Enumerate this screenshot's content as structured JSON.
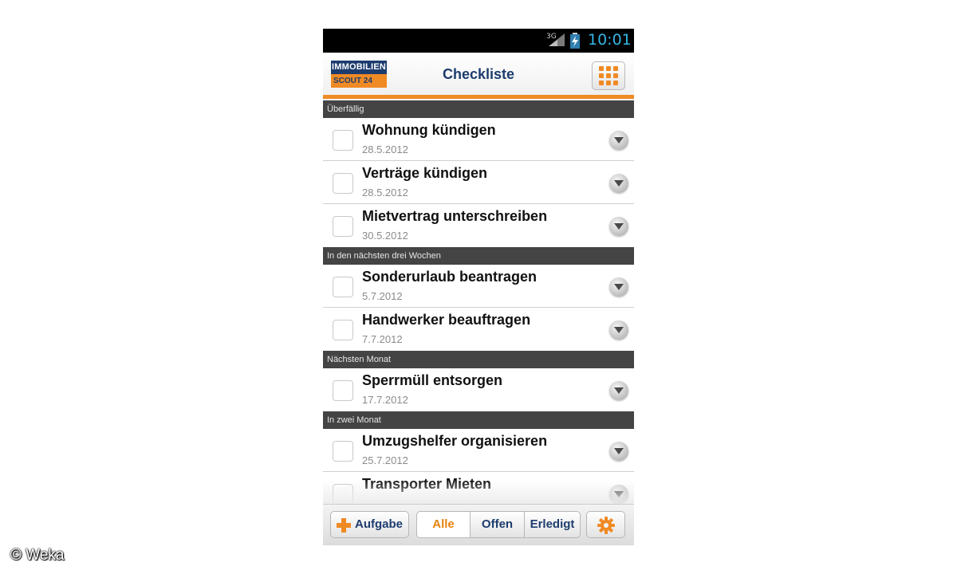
{
  "status_bar": {
    "network": "3G",
    "time": "10:01"
  },
  "app_bar": {
    "logo_line1": "IMMOBILIEN",
    "logo_line2": "SCOUT 24",
    "title": "Checkliste",
    "menu_icon": "grid-icon"
  },
  "sections": [
    {
      "header": "Überfällig",
      "items": [
        {
          "title": "Wohnung kündigen",
          "date": "28.5.2012"
        },
        {
          "title": "Verträge kündigen",
          "date": "28.5.2012"
        },
        {
          "title": "Mietvertrag unterschreiben",
          "date": "30.5.2012"
        }
      ]
    },
    {
      "header": "In den nächsten drei Wochen",
      "items": [
        {
          "title": "Sonderurlaub beantragen",
          "date": "5.7.2012"
        },
        {
          "title": "Handwerker beauftragen",
          "date": "7.7.2012"
        }
      ]
    },
    {
      "header": "Nächsten Monat",
      "items": [
        {
          "title": "Sperrmüll entsorgen",
          "date": "17.7.2012"
        }
      ]
    },
    {
      "header": "In zwei Monat",
      "items": [
        {
          "title": "Umzugshelfer organisieren",
          "date": "25.7.2012"
        },
        {
          "title": "Transporter Mieten",
          "date": ""
        }
      ]
    }
  ],
  "bottom_bar": {
    "add_label": "Aufgabe",
    "filter_all": "Alle",
    "filter_open": "Offen",
    "filter_done": "Erledigt",
    "selected_filter": "Alle",
    "settings_icon": "gear-icon"
  },
  "watermark": "© Weka",
  "colors": {
    "accent": "#f08a24",
    "brand": "#1d3c6e",
    "status_time": "#33b5e5",
    "section_header": "#444444"
  }
}
